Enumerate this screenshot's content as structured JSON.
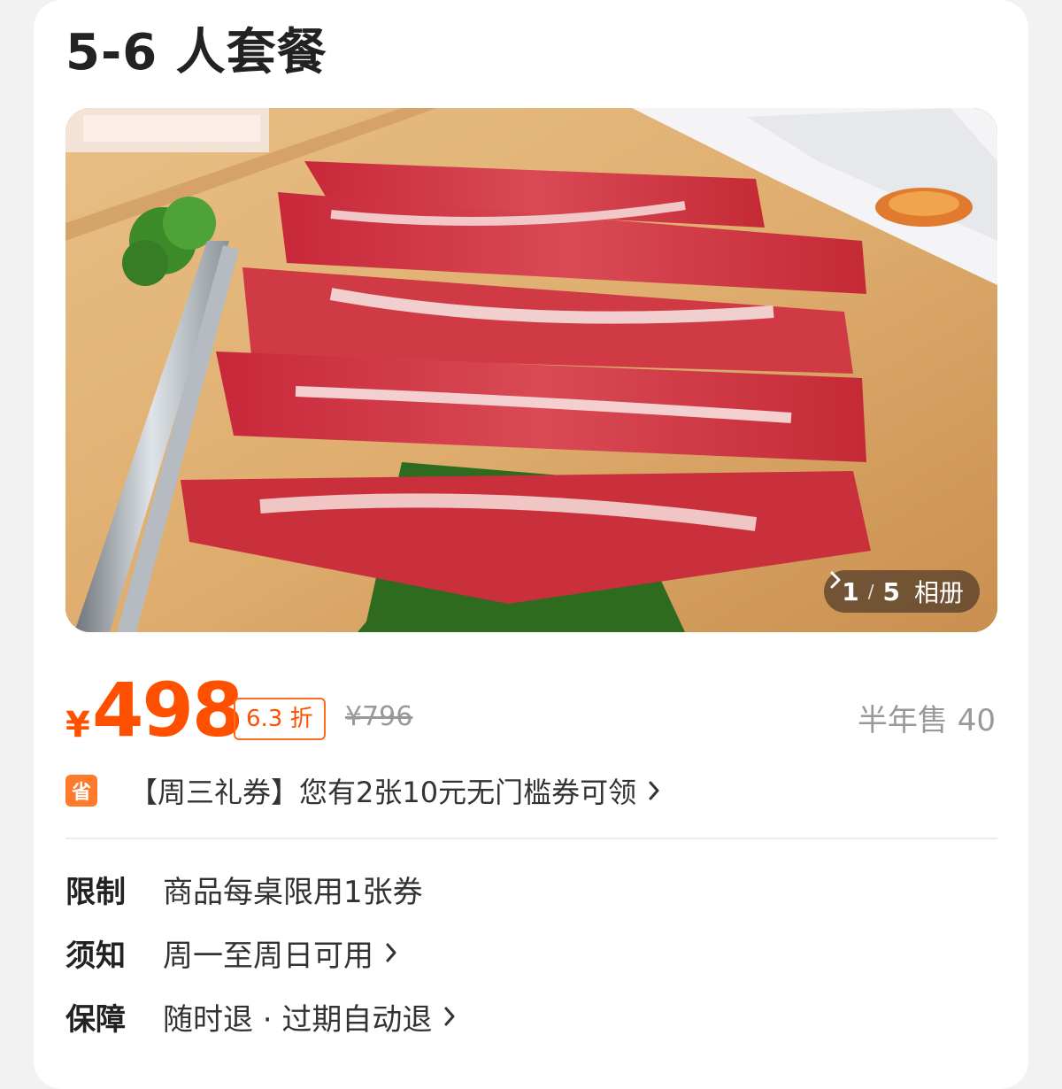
{
  "product": {
    "title": "5-6 人套餐"
  },
  "gallery": {
    "current": "1",
    "separator": "/",
    "total": "5",
    "album_label": "相册"
  },
  "pricing": {
    "currency": "¥",
    "price": "498",
    "discount": "6.3 折",
    "original_price": "¥796",
    "sold": "半年售 40"
  },
  "coupon": {
    "icon_text": "省",
    "text": "【周三礼券】您有2张10元无门槛券可领"
  },
  "info": {
    "limit_label": "限制",
    "limit_value": "商品每桌限用1张券",
    "notice_label": "须知",
    "notice_value": "周一至周日可用",
    "guarantee_label": "保障",
    "guarantee_value": "随时退 · 过期自动退"
  },
  "colors": {
    "accent": "#ff5000",
    "text": "#222222",
    "muted": "#999999"
  }
}
